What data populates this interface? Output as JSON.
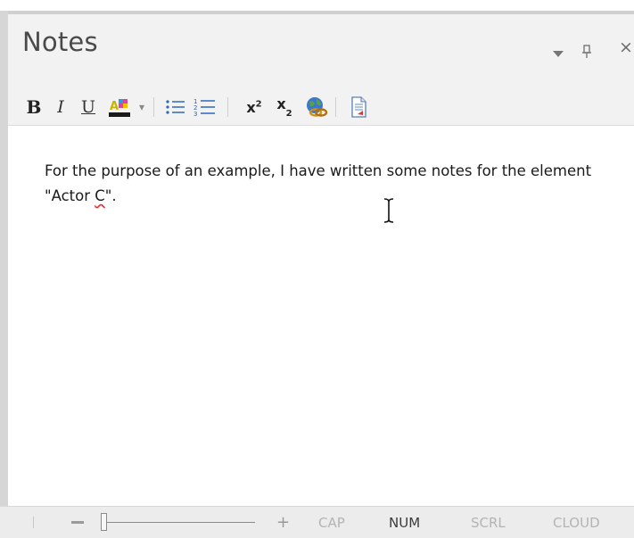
{
  "panel": {
    "title": "Notes",
    "pin_glyph": "Ɑ",
    "close_glyph": "×"
  },
  "toolbar": {
    "bold_label": "B",
    "italic_label": "I",
    "underline_label": "U",
    "dropdown_glyph": "▾",
    "superscript_base": "x",
    "superscript_exp": "2",
    "subscript_base": "x",
    "subscript_exp": "2"
  },
  "editor": {
    "text_before": "For the purpose of an example, I have written some notes for the element \"Actor ",
    "text_flagged": "C",
    "text_after": "\"."
  },
  "status": {
    "zoom_plus": "+",
    "cap": "CAP",
    "num": "NUM",
    "scrl": "SCRL",
    "cloud": "CLOUD"
  },
  "colors": {
    "text_color_swatch": "#1a1a1a",
    "spellcheck_underline": "#e03030",
    "status_active": "#3a3a3a",
    "status_inactive": "#b4b4b4"
  }
}
